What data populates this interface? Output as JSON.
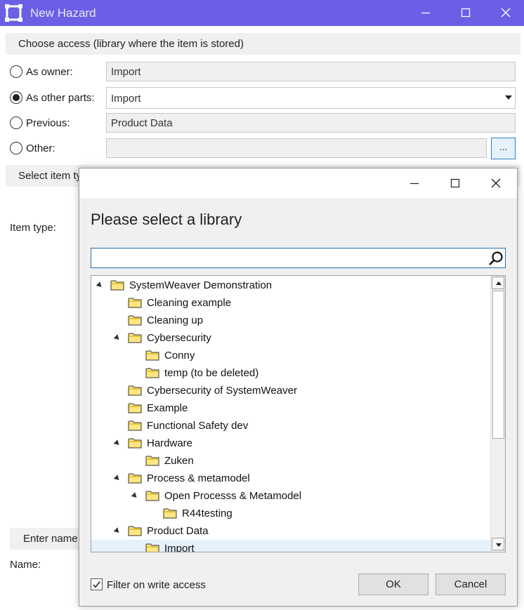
{
  "window": {
    "title": "New Hazard",
    "accent_color": "#6b5fe6"
  },
  "access": {
    "header": "Choose access (library where the item is stored)",
    "options": [
      {
        "label": "As owner:",
        "value": "Import",
        "checked": false
      },
      {
        "label": "As other parts:",
        "value": "Import",
        "checked": true
      },
      {
        "label": "Previous:",
        "value": "Product Data",
        "checked": false
      },
      {
        "label": "Other:",
        "value": "",
        "checked": false
      }
    ],
    "browse_label": "..."
  },
  "item_type": {
    "header": "Select item ty",
    "label": "Item type:"
  },
  "name_section": {
    "header": "Enter name",
    "label": "Name:"
  },
  "dialog": {
    "heading": "Please select a library",
    "search": {
      "value": "",
      "placeholder": ""
    },
    "tree": [
      {
        "label": "SystemWeaver Demonstration",
        "level": 0,
        "expanded": true,
        "selected": false
      },
      {
        "label": "Cleaning example",
        "level": 1,
        "expanded": false,
        "selected": false
      },
      {
        "label": "Cleaning up",
        "level": 1,
        "expanded": false,
        "selected": false
      },
      {
        "label": "Cybersecurity",
        "level": 1,
        "expanded": true,
        "selected": false
      },
      {
        "label": "Conny",
        "level": 2,
        "expanded": false,
        "selected": false
      },
      {
        "label": "temp (to be deleted)",
        "level": 2,
        "expanded": false,
        "selected": false
      },
      {
        "label": "Cybersecurity of SystemWeaver",
        "level": 1,
        "expanded": false,
        "selected": false
      },
      {
        "label": "Example",
        "level": 1,
        "expanded": false,
        "selected": false
      },
      {
        "label": "Functional Safety dev",
        "level": 1,
        "expanded": false,
        "selected": false
      },
      {
        "label": "Hardware",
        "level": 1,
        "expanded": true,
        "selected": false
      },
      {
        "label": "Zuken",
        "level": 2,
        "expanded": false,
        "selected": false
      },
      {
        "label": "Process & metamodel",
        "level": 1,
        "expanded": true,
        "selected": false
      },
      {
        "label": "Open Processs & Metamodel",
        "level": 2,
        "expanded": true,
        "selected": false
      },
      {
        "label": "R44testing",
        "level": 3,
        "expanded": false,
        "selected": false
      },
      {
        "label": "Product Data",
        "level": 1,
        "expanded": true,
        "selected": false
      },
      {
        "label": "Import",
        "level": 2,
        "expanded": false,
        "selected": true
      }
    ],
    "filter_label": "Filter on write access",
    "filter_checked": true,
    "ok_label": "OK",
    "cancel_label": "Cancel"
  }
}
